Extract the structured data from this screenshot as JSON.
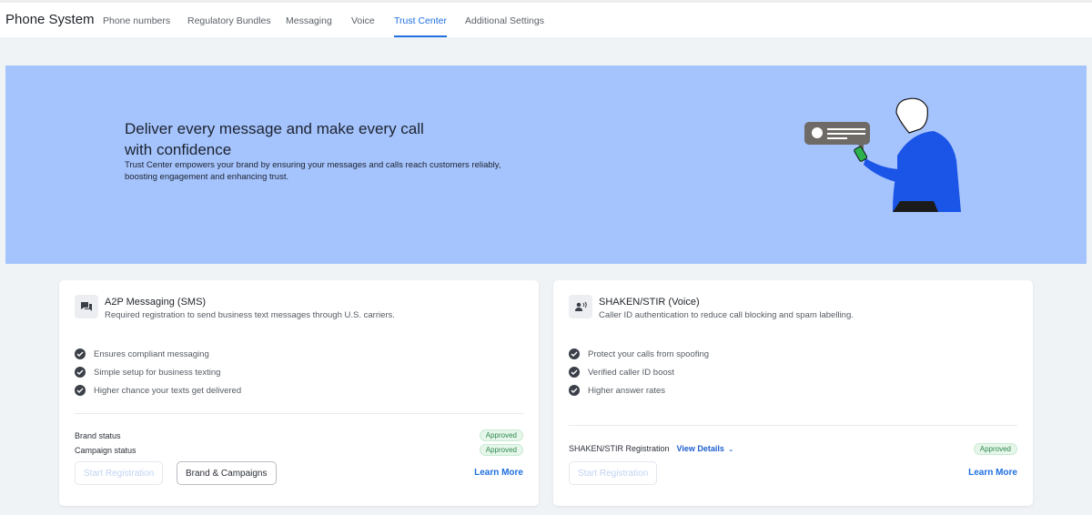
{
  "header": {
    "title": "Phone System",
    "tabs": [
      {
        "label": "Phone numbers"
      },
      {
        "label": "Regulatory Bundles"
      },
      {
        "label": "Messaging"
      },
      {
        "label": "Voice"
      },
      {
        "label": "Trust Center",
        "active": true
      },
      {
        "label": "Additional Settings"
      }
    ]
  },
  "banner": {
    "heading": "Deliver every message and make every call with confidence",
    "description": "Trust Center empowers your brand by ensuring your messages and calls reach customers reliably, boosting engagement and enhancing trust.",
    "color": "#a5c3fc"
  },
  "cards": [
    {
      "icon": "chat-icon",
      "title": "A2P Messaging (SMS)",
      "subtitle": "Required registration to send business text messages through U.S. carriers.",
      "features": [
        "Ensures compliant messaging",
        "Simple setup for business texting",
        "Higher chance your texts get delivered"
      ],
      "statuses": [
        {
          "label": "Brand status",
          "value": "Approved"
        },
        {
          "label": "Campaign status",
          "value": "Approved"
        }
      ],
      "start_label": "Start Registration",
      "secondary_label": "Brand & Campaigns",
      "learn_more": "Learn More"
    },
    {
      "icon": "voice-icon",
      "title": "SHAKEN/STIR (Voice)",
      "subtitle": "Caller ID authentication to reduce call blocking and spam labelling.",
      "features": [
        "Protect your calls from spoofing",
        "Verified caller ID boost",
        "Higher answer rates"
      ],
      "registration_label": "SHAKEN/STIR Registration",
      "view_details": "View Details",
      "status": "Approved",
      "start_label": "Start Registration",
      "learn_more": "Learn More"
    }
  ],
  "colors": {
    "accent": "#1f6fe0",
    "approved": "#2e8a4e"
  }
}
